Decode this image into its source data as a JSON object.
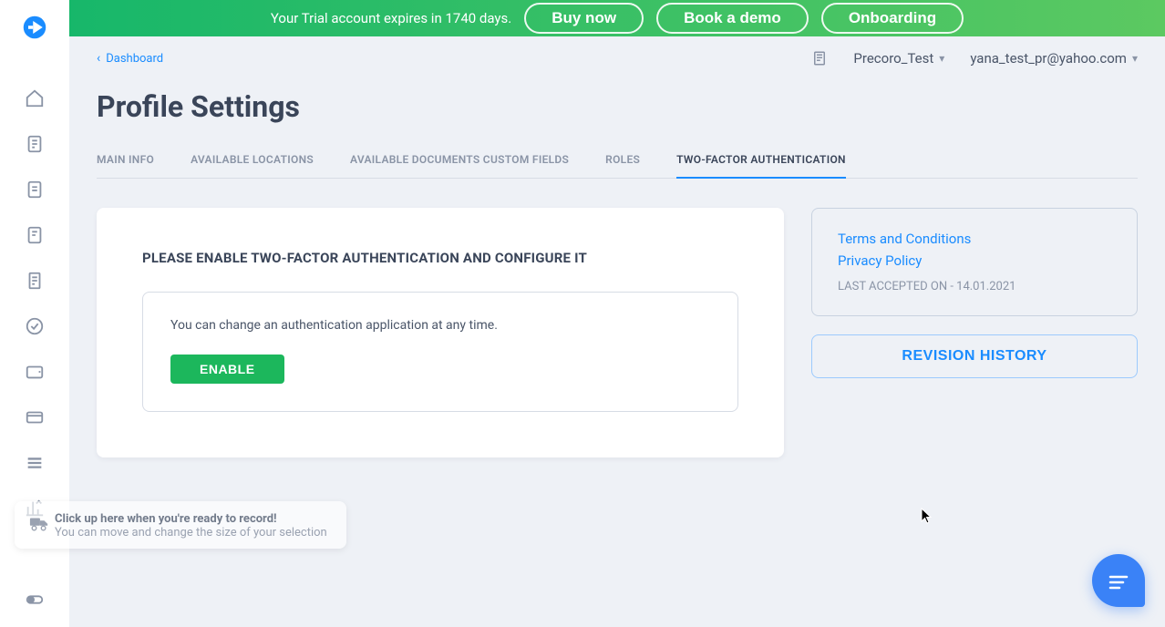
{
  "banner": {
    "message": "Your Trial account expires in 1740 days.",
    "buy": "Buy now",
    "demo": "Book a demo",
    "onboarding": "Onboarding"
  },
  "breadcrumb": {
    "label": "Dashboard"
  },
  "header": {
    "company": "Precoro_Test",
    "user": "yana_test_pr@yahoo.com"
  },
  "page": {
    "title": "Profile Settings"
  },
  "tabs": {
    "main": "MAIN INFO",
    "locations": "AVAILABLE LOCATIONS",
    "customFields": "AVAILABLE DOCUMENTS CUSTOM FIELDS",
    "roles": "ROLES",
    "twofa": "TWO-FACTOR AUTHENTICATION"
  },
  "twofa": {
    "title": "PLEASE ENABLE TWO-FACTOR AUTHENTICATION AND CONFIGURE IT",
    "desc": "You can change an authentication application at any time.",
    "enable": "ENABLE"
  },
  "side": {
    "terms": "Terms and Conditions",
    "privacy": "Privacy Policy",
    "accepted": "LAST ACCEPTED ON - 14.01.2021",
    "revision": "REVISION HISTORY"
  },
  "tooltip": {
    "title": "Click up here when you're ready to record!",
    "sub": "You can move and change the size of your selection"
  }
}
